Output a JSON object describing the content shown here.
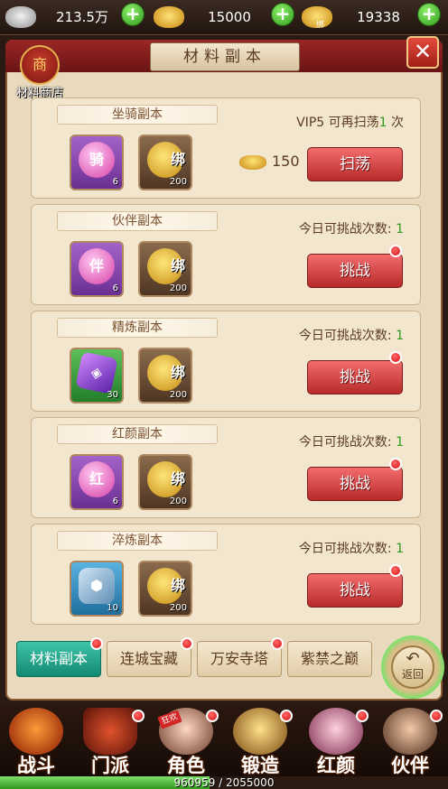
{
  "resources": {
    "silver": "213.5万",
    "gold": "15000",
    "bound_gold": "19338",
    "bound_badge": "绑"
  },
  "header": {
    "title": "材料副本",
    "close_label": "✕",
    "shop_label": "材料商店",
    "shop_glyph": "商"
  },
  "dungeons": [
    {
      "name": "坐骑副本",
      "item_glyph": "骑",
      "item_count": "6",
      "reward_label": "绑",
      "reward_count": "200",
      "info_prefix": "VIP5 可再扫荡",
      "info_num": "1",
      "info_suffix": " 次",
      "cost": "150",
      "button": "扫荡"
    },
    {
      "name": "伙伴副本",
      "item_glyph": "伴",
      "item_count": "6",
      "reward_label": "绑",
      "reward_count": "200",
      "info_prefix": "今日可挑战次数: ",
      "info_num": "1",
      "info_suffix": "",
      "button": "挑战"
    },
    {
      "name": "精炼副本",
      "item_glyph": "◈",
      "item_count": "30",
      "reward_label": "绑",
      "reward_count": "200",
      "info_prefix": "今日可挑战次数: ",
      "info_num": "1",
      "info_suffix": "",
      "button": "挑战"
    },
    {
      "name": "红颜副本",
      "item_glyph": "红",
      "item_count": "6",
      "reward_label": "绑",
      "reward_count": "200",
      "info_prefix": "今日可挑战次数: ",
      "info_num": "1",
      "info_suffix": "",
      "button": "挑战"
    },
    {
      "name": "淬炼副本",
      "item_glyph": "⬢",
      "item_count": "10",
      "reward_label": "绑",
      "reward_count": "200",
      "info_prefix": "今日可挑战次数: ",
      "info_num": "1",
      "info_suffix": "",
      "button": "挑战"
    }
  ],
  "tabs": [
    "材料副本",
    "连城宝藏",
    "万安寺塔",
    "紫禁之巅"
  ],
  "back_label": "返回",
  "nav": [
    "战斗",
    "门派",
    "角色",
    "锻造",
    "红颜",
    "伙伴"
  ],
  "hot_tag": "狂欢",
  "exp": {
    "text": "960959 / 2055000",
    "fraction": 0.468
  },
  "colors": {
    "accent_red": "#c83232",
    "accent_green": "#2f9a1d",
    "active_tab": "#1fa386"
  }
}
